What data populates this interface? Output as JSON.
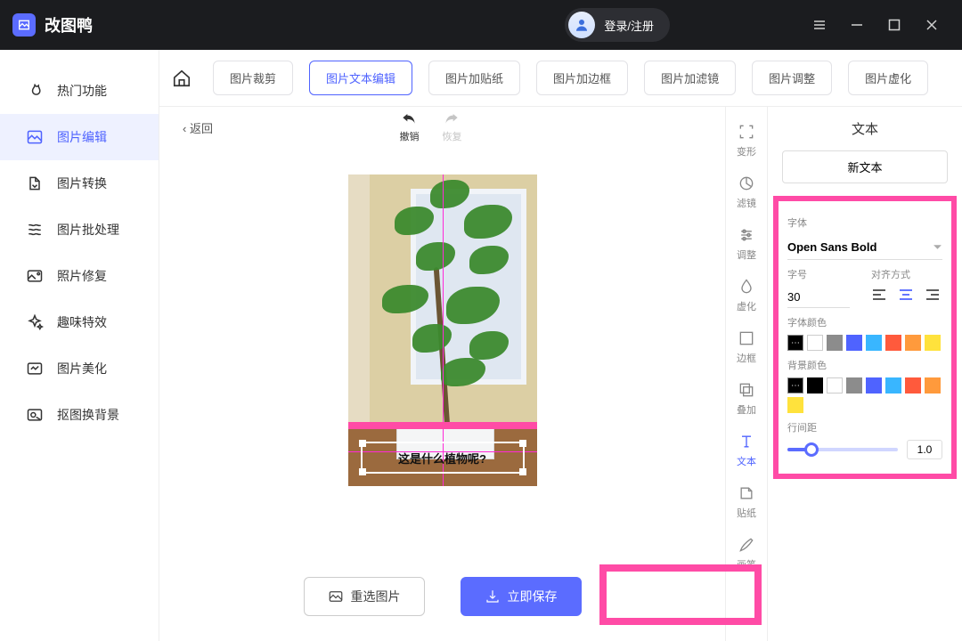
{
  "titlebar": {
    "appName": "改图鸭",
    "login": "登录/注册"
  },
  "sidebar": {
    "items": [
      {
        "label": "热门功能"
      },
      {
        "label": "图片编辑"
      },
      {
        "label": "图片转换"
      },
      {
        "label": "图片批处理"
      },
      {
        "label": "照片修复"
      },
      {
        "label": "趣味特效"
      },
      {
        "label": "图片美化"
      },
      {
        "label": "抠图换背景"
      }
    ]
  },
  "tabs": {
    "items": [
      {
        "label": "图片裁剪"
      },
      {
        "label": "图片文本编辑"
      },
      {
        "label": "图片加贴纸"
      },
      {
        "label": "图片加边框"
      },
      {
        "label": "图片加滤镜"
      },
      {
        "label": "图片调整"
      },
      {
        "label": "图片虚化"
      }
    ]
  },
  "canvas": {
    "back": "返回",
    "undo": "撤销",
    "redo": "恢复",
    "overlayText": "这是什么植物呢?",
    "rechoose": "重选图片",
    "save": "立即保存"
  },
  "toolcol": {
    "items": [
      {
        "label": "变形"
      },
      {
        "label": "滤镜"
      },
      {
        "label": "调整"
      },
      {
        "label": "虚化"
      },
      {
        "label": "边框"
      },
      {
        "label": "叠加"
      },
      {
        "label": "文本"
      },
      {
        "label": "贴纸"
      },
      {
        "label": "画笔"
      }
    ]
  },
  "panel": {
    "title": "文本",
    "newText": "新文本",
    "fontLabel": "字体",
    "fontValue": "Open Sans Bold",
    "sizeLabel": "字号",
    "sizeValue": "30",
    "alignLabel": "对齐方式",
    "fontColorLabel": "字体颜色",
    "bgColorLabel": "背景颜色",
    "lineHeightLabel": "行间距",
    "lineHeightValue": "1.0",
    "fontColors": [
      "#ffffff",
      "#8c8c8c",
      "#4f63ff",
      "#39b6ff",
      "#ff5a3c",
      "#ff9a3c",
      "#ffe23c"
    ],
    "bgColors": [
      "#000000",
      "#ffffff",
      "#8c8c8c",
      "#4f63ff",
      "#39b6ff",
      "#ff5a3c",
      "#ff9a3c",
      "#ffe23c"
    ]
  }
}
